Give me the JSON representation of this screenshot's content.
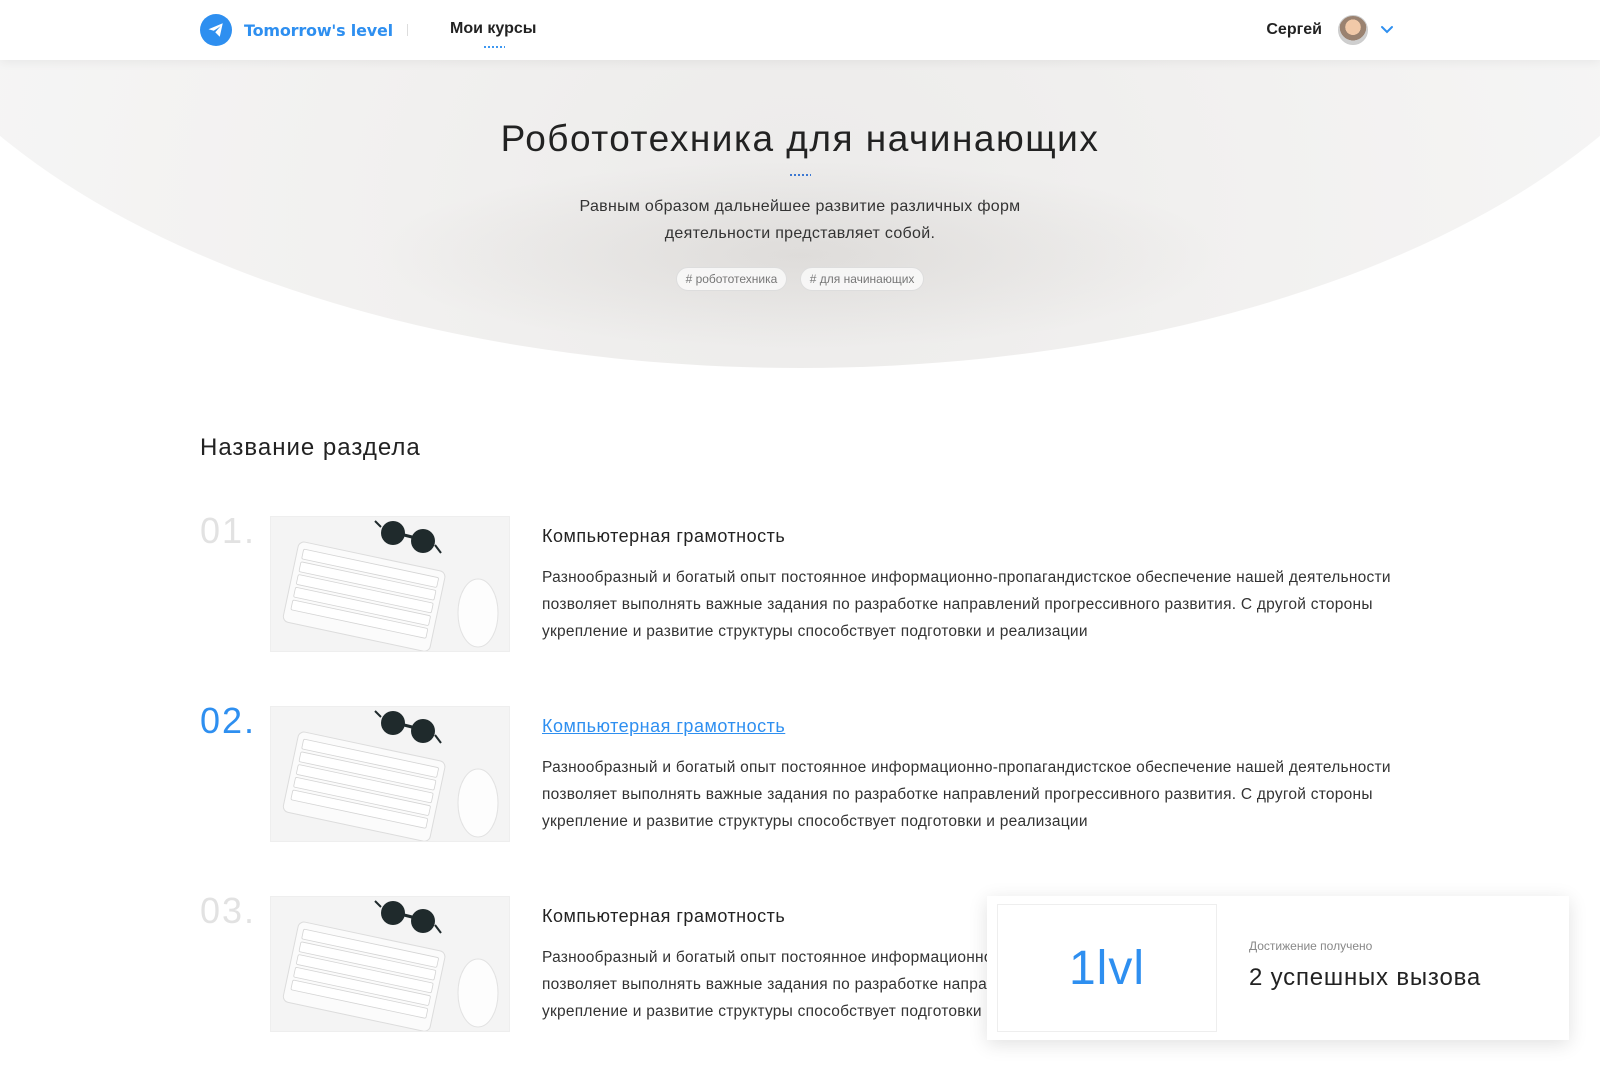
{
  "header": {
    "logo_text": "Tomorrow's level",
    "nav_label": "Мои курсы",
    "user_name": "Сергей"
  },
  "hero": {
    "title": "Робототехника для начинающих",
    "subtitle": "Равным образом дальнейшее развитие различных форм деятельности представляет собой.",
    "tags": [
      "# робототехника",
      "# для начинающих"
    ]
  },
  "section": {
    "title": "Название раздела",
    "lessons": [
      {
        "number": "01.",
        "title": "Компьютерная грамотность",
        "description": "Разнообразный и богатый опыт постоянное информационно-пропагандистское обеспечение нашей деятельности позволяет выполнять важные задания по разработке направлений прогрессивного развития. С другой стороны укрепление и развитие структуры способствует подготовки и реализации",
        "active": false
      },
      {
        "number": "02.",
        "title": "Компьютерная грамотность",
        "description": "Разнообразный и богатый опыт постоянное информационно-пропагандистское обеспечение нашей деятельности позволяет выполнять важные задания по разработке направлений прогрессивного развития. С другой стороны укрепление и развитие структуры способствует подготовки и реализации",
        "active": true
      },
      {
        "number": "03.",
        "title": "Компьютерная грамотность",
        "description": "Разнообразный и богатый опыт постоянное информационно-пропагандистское обеспечение нашей деятельности позволяет выполнять важные задания по разработке направлений прогрессивного развития. С другой стороны укрепление и развитие структуры способствует подготовки и реализации",
        "active": false
      }
    ]
  },
  "achievement": {
    "level": "1lvl",
    "caption": "Достижение получено",
    "text": "2 успешных вызова"
  },
  "colors": {
    "accent": "#2e8ff0",
    "muted_number": "#e2e2e2",
    "text": "#222222"
  },
  "icons": {
    "logo": "paper-plane-icon",
    "user_menu": "chevron-down-icon",
    "thumbnail": "keyboard-sunglasses-image"
  }
}
